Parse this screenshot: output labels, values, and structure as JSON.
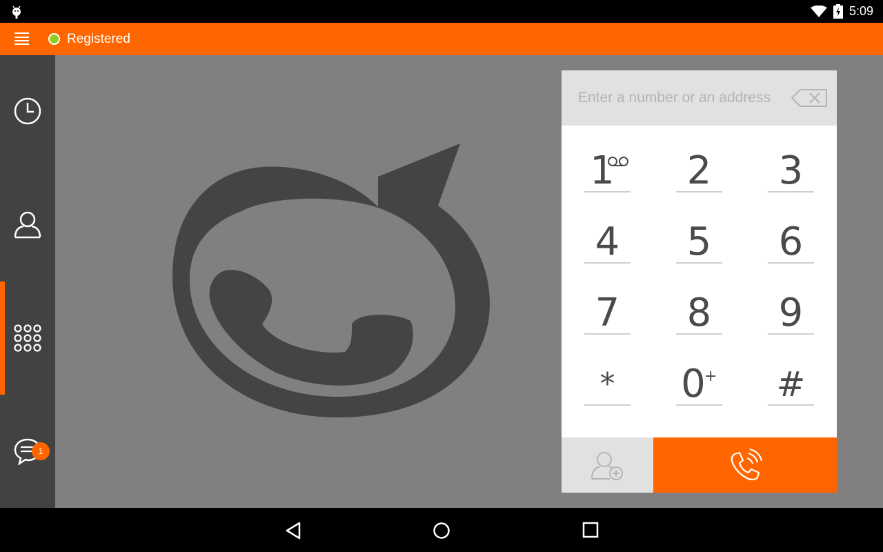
{
  "status_bar": {
    "time": "5:09"
  },
  "top_bar": {
    "status_label": "Registered",
    "status_color": "#8bcf23",
    "accent": "#ff6600"
  },
  "sidebar": {
    "items": [
      {
        "icon": "history-icon"
      },
      {
        "icon": "contacts-icon"
      },
      {
        "icon": "dialer-icon",
        "active": true
      },
      {
        "icon": "chat-icon",
        "badge": "1"
      }
    ]
  },
  "dialer": {
    "address_placeholder": "Enter a number or an address",
    "address_value": "",
    "keys": [
      {
        "digit": "1",
        "extra": "voicemail-icon"
      },
      {
        "digit": "2"
      },
      {
        "digit": "3"
      },
      {
        "digit": "4"
      },
      {
        "digit": "5"
      },
      {
        "digit": "6"
      },
      {
        "digit": "7"
      },
      {
        "digit": "8"
      },
      {
        "digit": "9"
      },
      {
        "digit": "*"
      },
      {
        "digit": "0",
        "extra": "+"
      },
      {
        "digit": "#"
      }
    ]
  }
}
